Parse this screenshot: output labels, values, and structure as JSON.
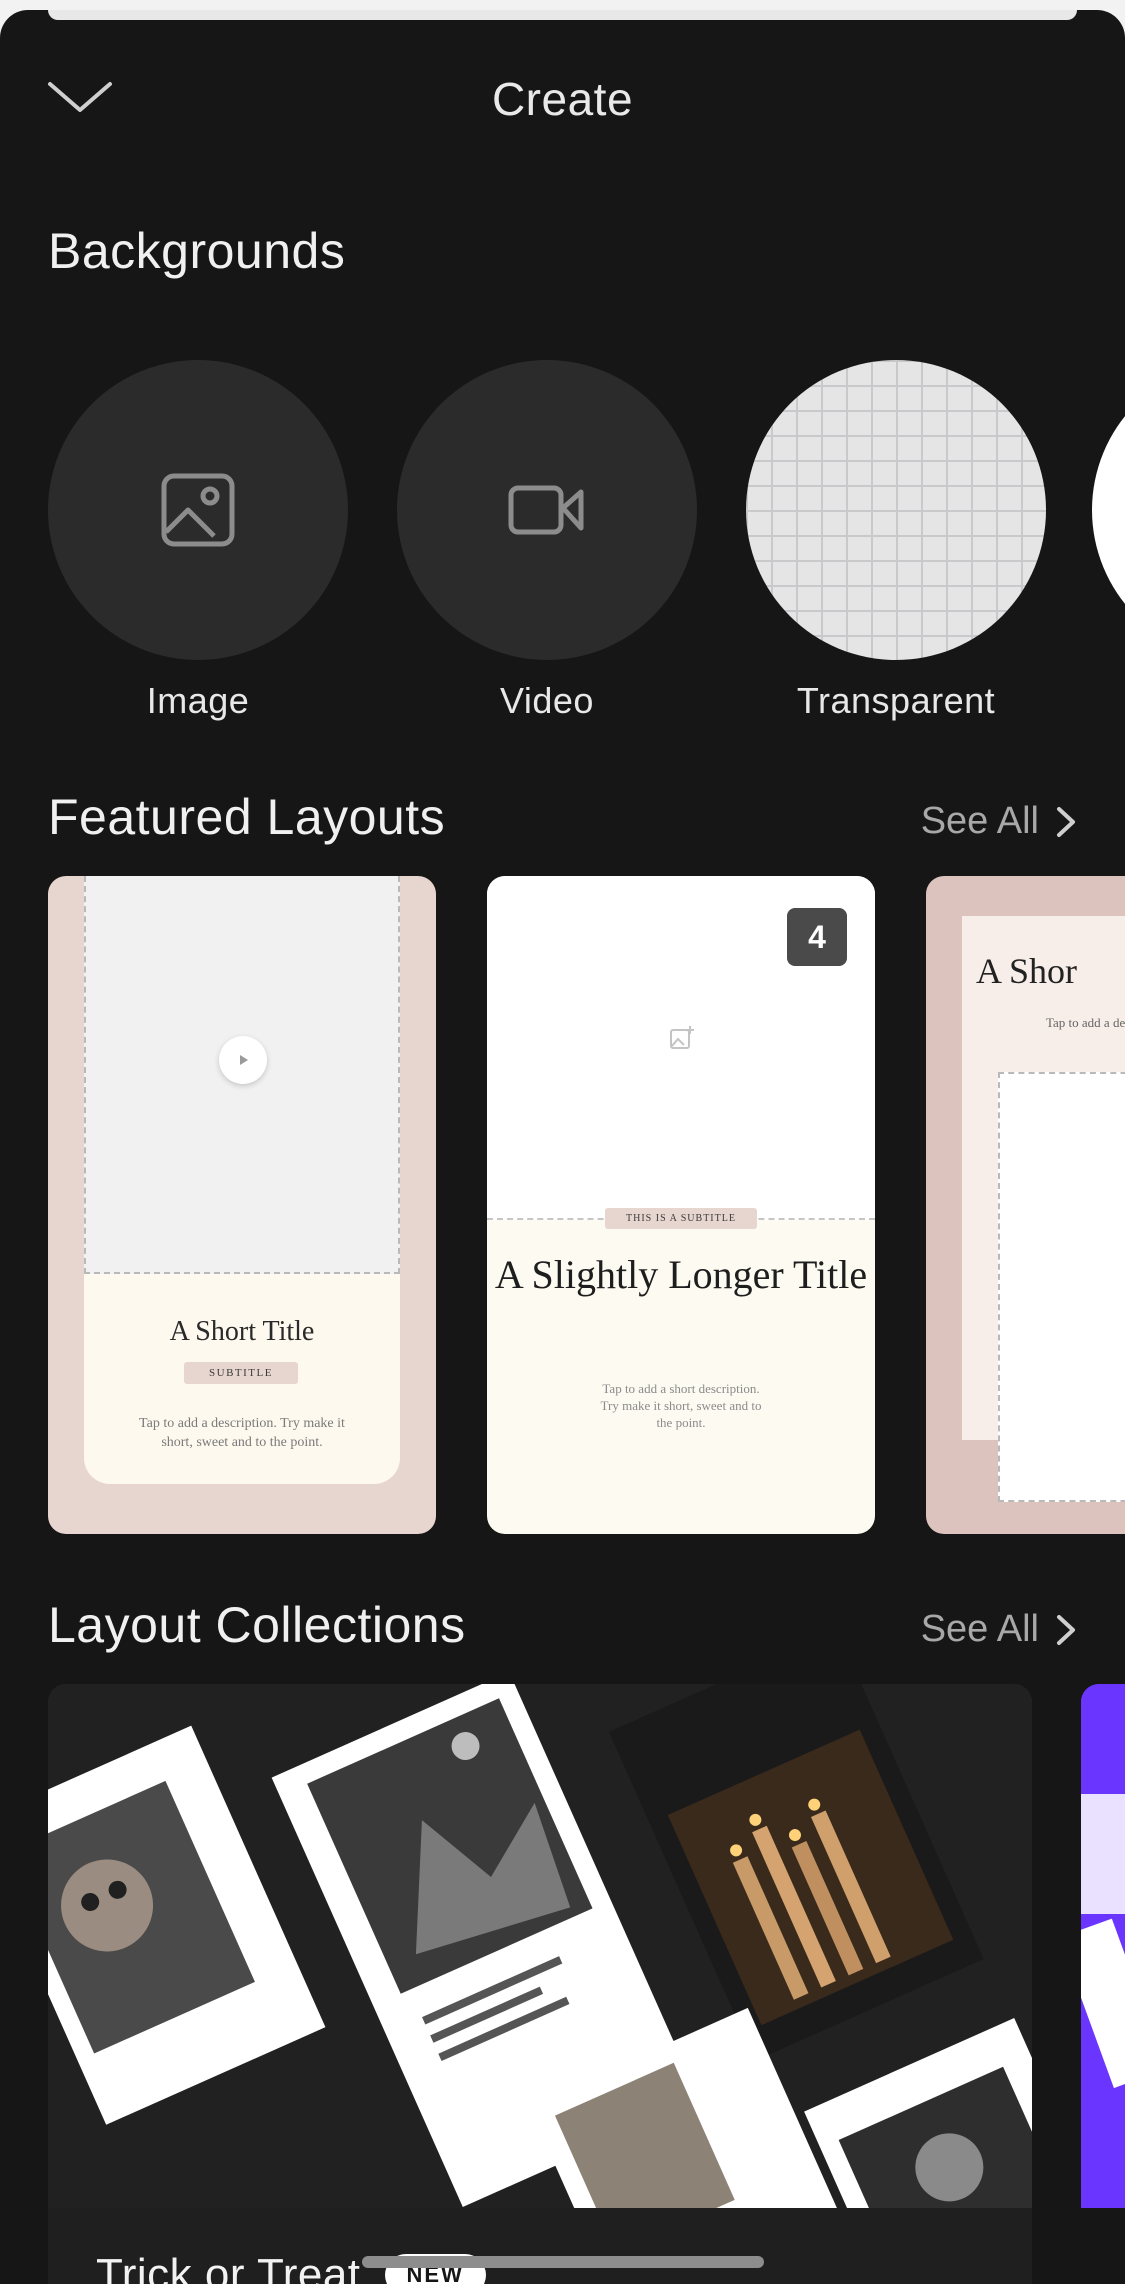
{
  "header": {
    "title": "Create"
  },
  "backgrounds": {
    "title": "Backgrounds",
    "items": [
      {
        "label": "Image",
        "icon": "image-icon"
      },
      {
        "label": "Video",
        "icon": "video-camera-icon"
      },
      {
        "label": "Transparent",
        "icon": "transparent-grid"
      }
    ]
  },
  "featured": {
    "title": "Featured Layouts",
    "see_all": "See All",
    "cards": [
      {
        "title": "A Short Title",
        "subtitle": "SUBTITLE",
        "description": "Tap to add a description. Try make it short, sweet and to the point."
      },
      {
        "badge": "4",
        "subtitle": "THIS IS A SUBTITLE",
        "title": "A Slightly Longer Title",
        "description": "Tap to add a short description. Try make it short, sweet and to the point."
      },
      {
        "title": "A Shor",
        "description": "Tap to add a de tell your"
      }
    ]
  },
  "collections": {
    "title": "Layout Collections",
    "see_all": "See All",
    "items": [
      {
        "name": "Trick or Treat",
        "badge": "NEW"
      }
    ]
  },
  "colors": {
    "sheet_bg": "#161617",
    "accent_purple": "#6a35ff",
    "card_pink": "#e7d5cf"
  }
}
